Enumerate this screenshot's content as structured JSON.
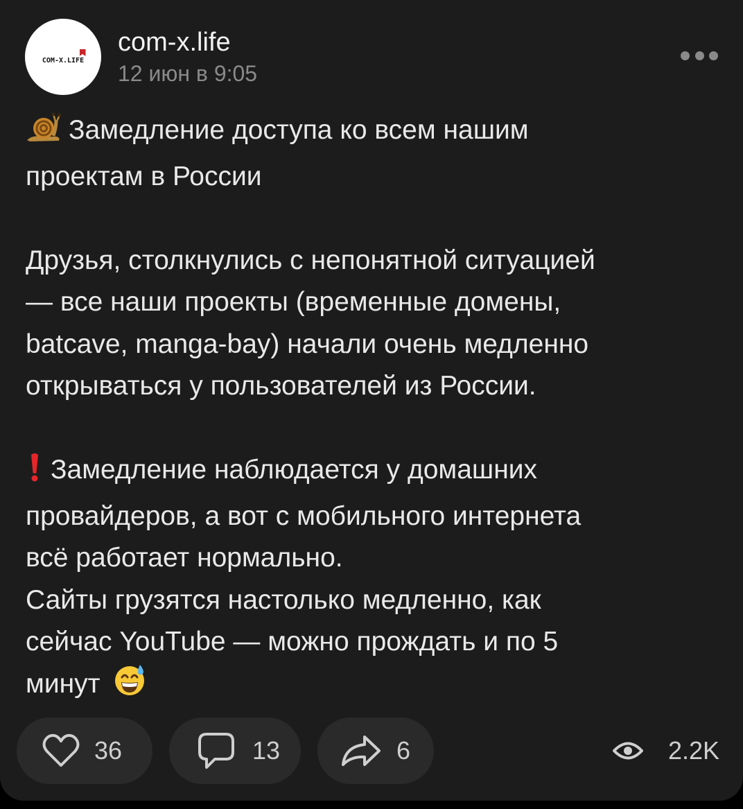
{
  "post": {
    "channel_name": "com-x.life",
    "avatar_text": "COM-X.LIFE",
    "date": "12 июн в 9:05",
    "title_line1": "Замедление доступа ко всем нашим",
    "title_line2": "проектам в России",
    "paragraph1": [
      "Друзья, столкнулись с непонятной ситуацией",
      "— все наши проекты (временные домены,",
      "batcave, manga-bay) начали очень медленно",
      "открываться у пользователей из России."
    ],
    "warning_line1": "Замедление наблюдается у домашних",
    "paragraph2": [
      "провайдеров, а вот с мобильного интернета",
      "всё работает нормально.",
      "Сайты грузятся настолько медленно, как",
      "сейчас YouTube — можно прождать и по 5"
    ],
    "last_line": "минут"
  },
  "actions": {
    "likes": "36",
    "comments": "13",
    "shares": "6",
    "views": "2.2K"
  },
  "icons": {
    "title_emoji": "snail-icon",
    "warning_emoji": "exclamation-icon",
    "end_emoji": "grinning-sweat-icon",
    "like": "heart-icon",
    "comment": "comment-icon",
    "share": "share-icon",
    "views": "eye-icon",
    "more": "more-dots-icon"
  },
  "colors": {
    "background": "#000000",
    "card": "#1c1c1c",
    "pill": "#2a2a2a",
    "text": "#e9e9e9",
    "muted": "#8a8a8a",
    "brand_red": "#c7262b"
  }
}
